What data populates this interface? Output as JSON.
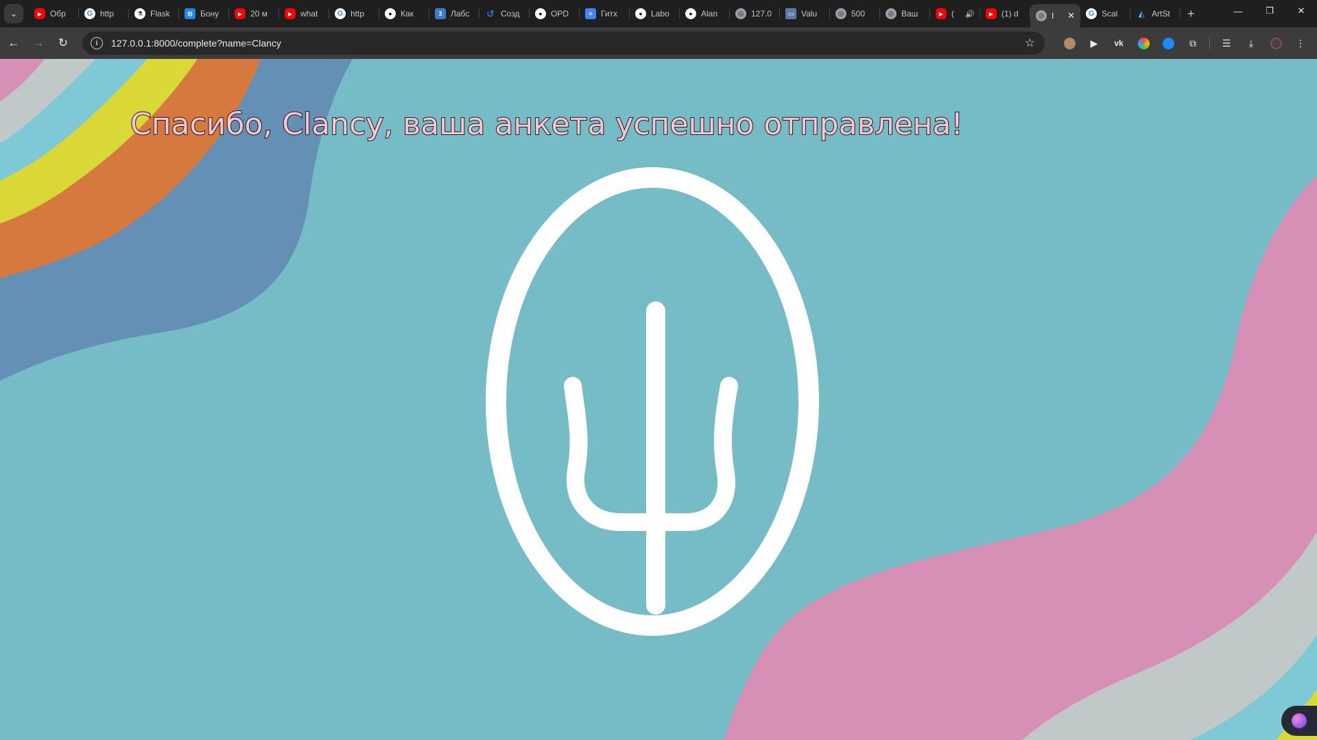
{
  "browser": {
    "tabs": [
      {
        "icon": "youtube-icon",
        "title": "Обр"
      },
      {
        "icon": "google-icon",
        "title": "http"
      },
      {
        "icon": "flask-icon",
        "title": "Flask"
      },
      {
        "icon": "blue-app-icon",
        "title": "Бону"
      },
      {
        "icon": "youtube-icon",
        "title": "20 м"
      },
      {
        "icon": "youtube-icon",
        "title": "what"
      },
      {
        "icon": "google-icon",
        "title": "http"
      },
      {
        "icon": "github-icon",
        "title": "Как"
      },
      {
        "icon": "number-3-icon",
        "title": "Лабс"
      },
      {
        "icon": "swirl-icon",
        "title": "Созд"
      },
      {
        "icon": "github-icon",
        "title": "OPD"
      },
      {
        "icon": "docs-icon",
        "title": "Гитх"
      },
      {
        "icon": "github-icon",
        "title": "Labo"
      },
      {
        "icon": "github-icon",
        "title": "Alan"
      },
      {
        "icon": "globe-icon",
        "title": "127.0"
      },
      {
        "icon": "window-icon",
        "title": "Valu"
      },
      {
        "icon": "globe-icon",
        "title": "500"
      },
      {
        "icon": "globe-icon",
        "title": "Ваш"
      },
      {
        "icon": "youtube-icon",
        "title": "("
      },
      {
        "icon": "youtube-icon",
        "title": "(1) d"
      },
      {
        "icon": "globe-icon",
        "title": "I"
      },
      {
        "icon": "google-icon",
        "title": "Scal"
      },
      {
        "icon": "artstation-icon",
        "title": "ArtSt"
      }
    ],
    "active_tab_index": 20,
    "address": {
      "url": "127.0.0.1:8000/complete?name=Clancy"
    },
    "window_controls": {
      "minimize": "—",
      "restore": "❐",
      "close": "✕"
    },
    "new_tab": "+"
  },
  "page": {
    "heading": "Спасибо, Clancy, ваша анкета успешно отправлена!",
    "colors": {
      "background": "#75bcc7",
      "stripe_pink": "#d68fb5",
      "stripe_silver": "#c0c9c8",
      "stripe_light_blue": "#7fc8d5",
      "stripe_yellow": "#d9d836",
      "stripe_orange": "#d6793e",
      "stripe_steel_blue": "#6590b5",
      "heading_fill": "#f6c7d3",
      "emblem": "#ffffff"
    }
  }
}
